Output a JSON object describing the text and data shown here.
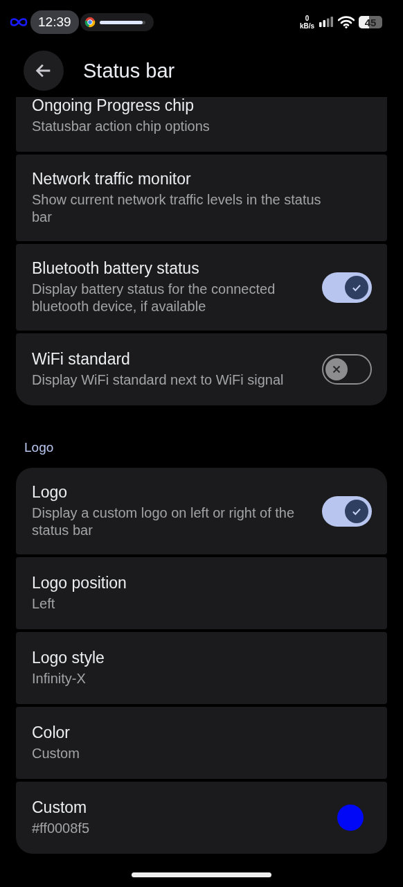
{
  "status_bar": {
    "time": "12:39",
    "progress": {
      "level": 0.95
    },
    "net_speed_value": "0",
    "net_speed_unit": "kB/s",
    "battery": "45"
  },
  "header": {
    "title": "Status bar"
  },
  "groups": [
    {
      "items": [
        {
          "kind": "plain",
          "title": "Ongoing Progress chip",
          "summary": "Statusbar action chip options"
        },
        {
          "kind": "plain",
          "title": "Network traffic monitor",
          "summary": "Show current network traffic levels in the status bar"
        },
        {
          "kind": "toggle",
          "title": "Bluetooth battery status",
          "summary": "Display battery status for the connected bluetooth device, if available",
          "on": true
        },
        {
          "kind": "toggle",
          "title": "WiFi standard",
          "summary": "Display WiFi standard next to WiFi signal",
          "on": false
        }
      ]
    },
    {
      "heading": "Logo",
      "items": [
        {
          "kind": "toggle",
          "title": "Logo",
          "summary": "Display a custom logo on left or right of the status bar",
          "on": true
        },
        {
          "kind": "plain",
          "title": "Logo position",
          "summary": "Left"
        },
        {
          "kind": "plain",
          "title": "Logo style",
          "summary": "Infinity-X"
        },
        {
          "kind": "plain",
          "title": "Color",
          "summary": "Custom"
        },
        {
          "kind": "color",
          "title": "Custom",
          "summary": "#ff0008f5",
          "color": "#0008f5"
        }
      ]
    }
  ]
}
